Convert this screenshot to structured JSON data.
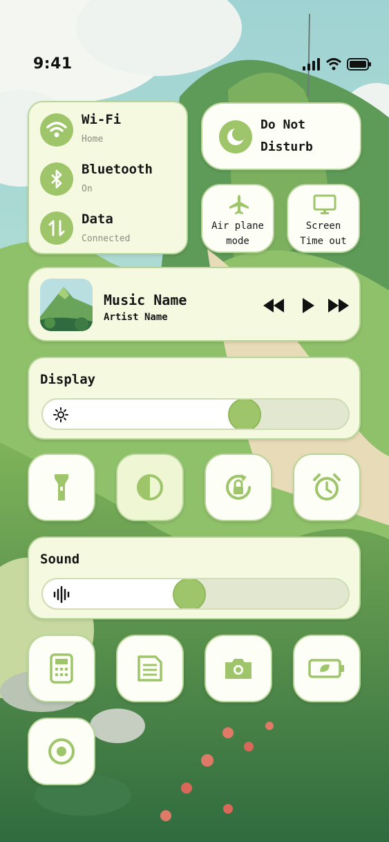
{
  "status_bar": {
    "time": "9:41"
  },
  "connectivity": {
    "wifi": {
      "label": "Wi-Fi",
      "status": "Home"
    },
    "bluetooth": {
      "label": "Bluetooth",
      "status": "On"
    },
    "data": {
      "label": "Data",
      "status": "Connected"
    }
  },
  "do_not_disturb": {
    "line1": "Do Not",
    "line2": "Disturb"
  },
  "airplane": {
    "line1": "Air plane",
    "line2": "mode"
  },
  "screen_timeout": {
    "line1": "Screen",
    "line2": "Time out"
  },
  "music": {
    "title": "Music Name",
    "artist": "Artist Name"
  },
  "display": {
    "label": "Display",
    "level": 0.66
  },
  "sound": {
    "label": "Sound",
    "level": 0.48
  },
  "toggles_row1": [
    "flashlight-icon",
    "contrast-icon",
    "rotation-lock-icon",
    "alarm-icon"
  ],
  "toggles_row2": [
    "calculator-icon",
    "notes-icon",
    "camera-icon",
    "battery-icon",
    "record-icon"
  ],
  "colors": {
    "accent": "#9ec56a",
    "card": "#f4f9df",
    "tile": "#fdfff7",
    "border": "#b8d69a"
  }
}
